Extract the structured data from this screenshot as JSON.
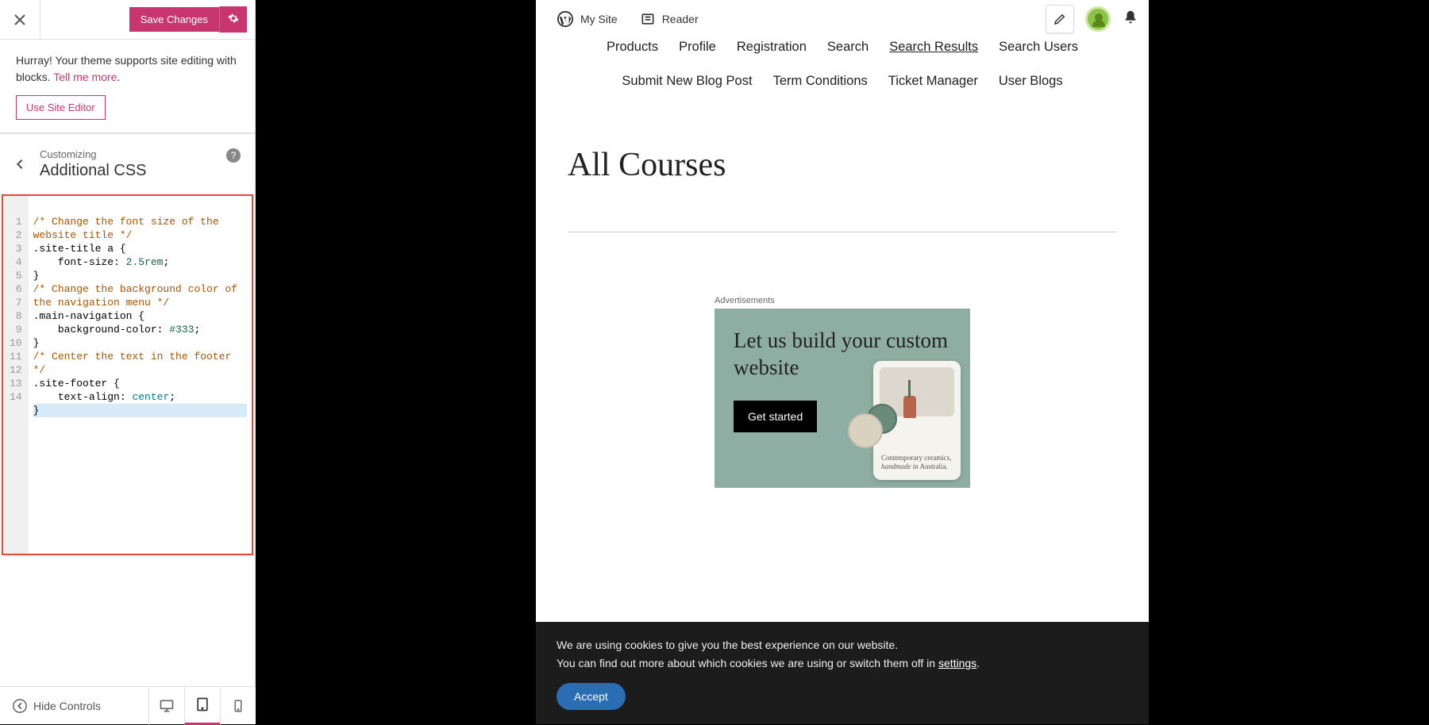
{
  "sidebar": {
    "save_label": "Save Changes",
    "notice_text": "Hurray! Your theme supports site editing with blocks. ",
    "tell_more": "Tell me more",
    "use_editor_label": "Use Site Editor",
    "customizing_label": "Customizing",
    "section_title": "Additional CSS",
    "hide_controls_label": "Hide Controls"
  },
  "css_lines": [
    {
      "n": "1",
      "html": "<span class='cm-comment'>/* Change the font size of the website title */</span>"
    },
    {
      "n": "2",
      "html": "<span class='cm-selector'>.site-title a</span> <span class='cm-punct'>{</span>"
    },
    {
      "n": "3",
      "html": "    <span class='cm-prop'>font-size</span>: <span class='cm-number'>2.5rem</span>;"
    },
    {
      "n": "4",
      "html": "<span class='cm-punct'>}</span>"
    },
    {
      "n": "5",
      "html": ""
    },
    {
      "n": "6",
      "html": "<span class='cm-comment'>/* Change the background color of the navigation menu */</span>"
    },
    {
      "n": "7",
      "html": "<span class='cm-selector'>.main-navigation</span> <span class='cm-punct'>{</span>"
    },
    {
      "n": "8",
      "html": "    <span class='cm-prop'>background-color</span>: <span class='cm-number'>#333</span>;"
    },
    {
      "n": "9",
      "html": "<span class='cm-punct'>}</span>"
    },
    {
      "n": "10",
      "html": ""
    },
    {
      "n": "11",
      "html": "<span class='cm-comment'>/* Center the text in the footer */</span>"
    },
    {
      "n": "12",
      "html": "<span class='cm-selector'>.site-footer</span> <span class='cm-punct'>{</span>"
    },
    {
      "n": "13",
      "html": "    <span class='cm-prop'>text-align</span>: <span class='cm-value'>center</span>;"
    },
    {
      "n": "14",
      "html": "<span class='cm-punct'>}</span>",
      "cursor": true
    }
  ],
  "wp_bar": {
    "my_site": "My Site",
    "reader": "Reader"
  },
  "nav": {
    "row1": [
      "Products",
      "Profile",
      "Registration",
      "Search",
      "Search Results",
      "Search Users"
    ],
    "row1_active_index": 4,
    "row2": [
      "Submit New Blog Post",
      "Term Conditions",
      "Ticket Manager",
      "User Blogs"
    ]
  },
  "page": {
    "title": "All Courses"
  },
  "ad": {
    "label": "Advertisements",
    "headline": "Let us build your custom website",
    "cta": "Get started",
    "card_line1": "Contemporary ceramics,",
    "card_line2_em": "handmade",
    "card_line2_rest": " in Australia."
  },
  "cookie": {
    "line1": "We are using cookies to give you the best experience on our website.",
    "line2_a": "You can find out more about which cookies we are using or switch them off in ",
    "settings_link": "settings",
    "accept": "Accept"
  }
}
